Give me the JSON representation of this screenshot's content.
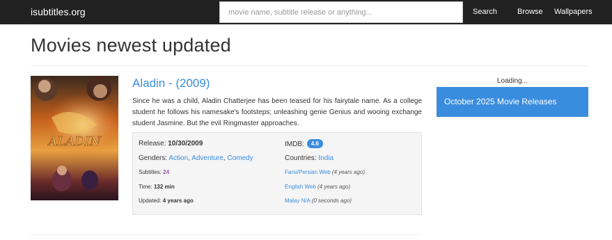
{
  "navbar": {
    "brand": "isubtitles.org",
    "search_placeholder": "movie name, subtitle release or anything...",
    "search_value": "",
    "links": {
      "search": "Search",
      "browse": "Browse",
      "wallpapers": "Wallpapers"
    }
  },
  "page": {
    "title": "Movies newest updated"
  },
  "movie": {
    "poster_text": "ALADIN",
    "title": "Aladin - (2009)",
    "description": "Since he was a child, Aladin Chatterjee has been teased for his fairytale name. As a college student he follows his namesake's footsteps; unleashing genie Genius and wooing exchange student Jasmine. But the evil Ringmaster approaches.",
    "release_label": "Release:",
    "release_value": "10/30/2009",
    "imdb_label": "IMDB:",
    "imdb_value": "4.6",
    "genders_label": "Genders:",
    "genres": [
      "Action",
      "Adventure",
      "Comedy"
    ],
    "genre_separator": ", ",
    "countries_label": "Countries:",
    "country": "India",
    "subtitles_label": "Subtitles:",
    "subtitles_count": "24",
    "time_label": "Time:",
    "time_value": "132 min",
    "updated_label": "Updated:",
    "updated_value": "4 years ago",
    "subtitle_entries": [
      {
        "lang": "Farsi/Persian Web",
        "age": "(4 years ago)"
      },
      {
        "lang": "English Web",
        "age": "(4 years ago)"
      },
      {
        "lang": "Malay N/A",
        "age": "(0 seconds ago)"
      }
    ]
  },
  "sidebar": {
    "loading": "Loading...",
    "promo": "October 2025 Movie Releases"
  },
  "colors": {
    "navbar": "#212121",
    "accent": "#3a8dde",
    "count": "#9b59b6",
    "info_bg": "#f5f5f5"
  }
}
